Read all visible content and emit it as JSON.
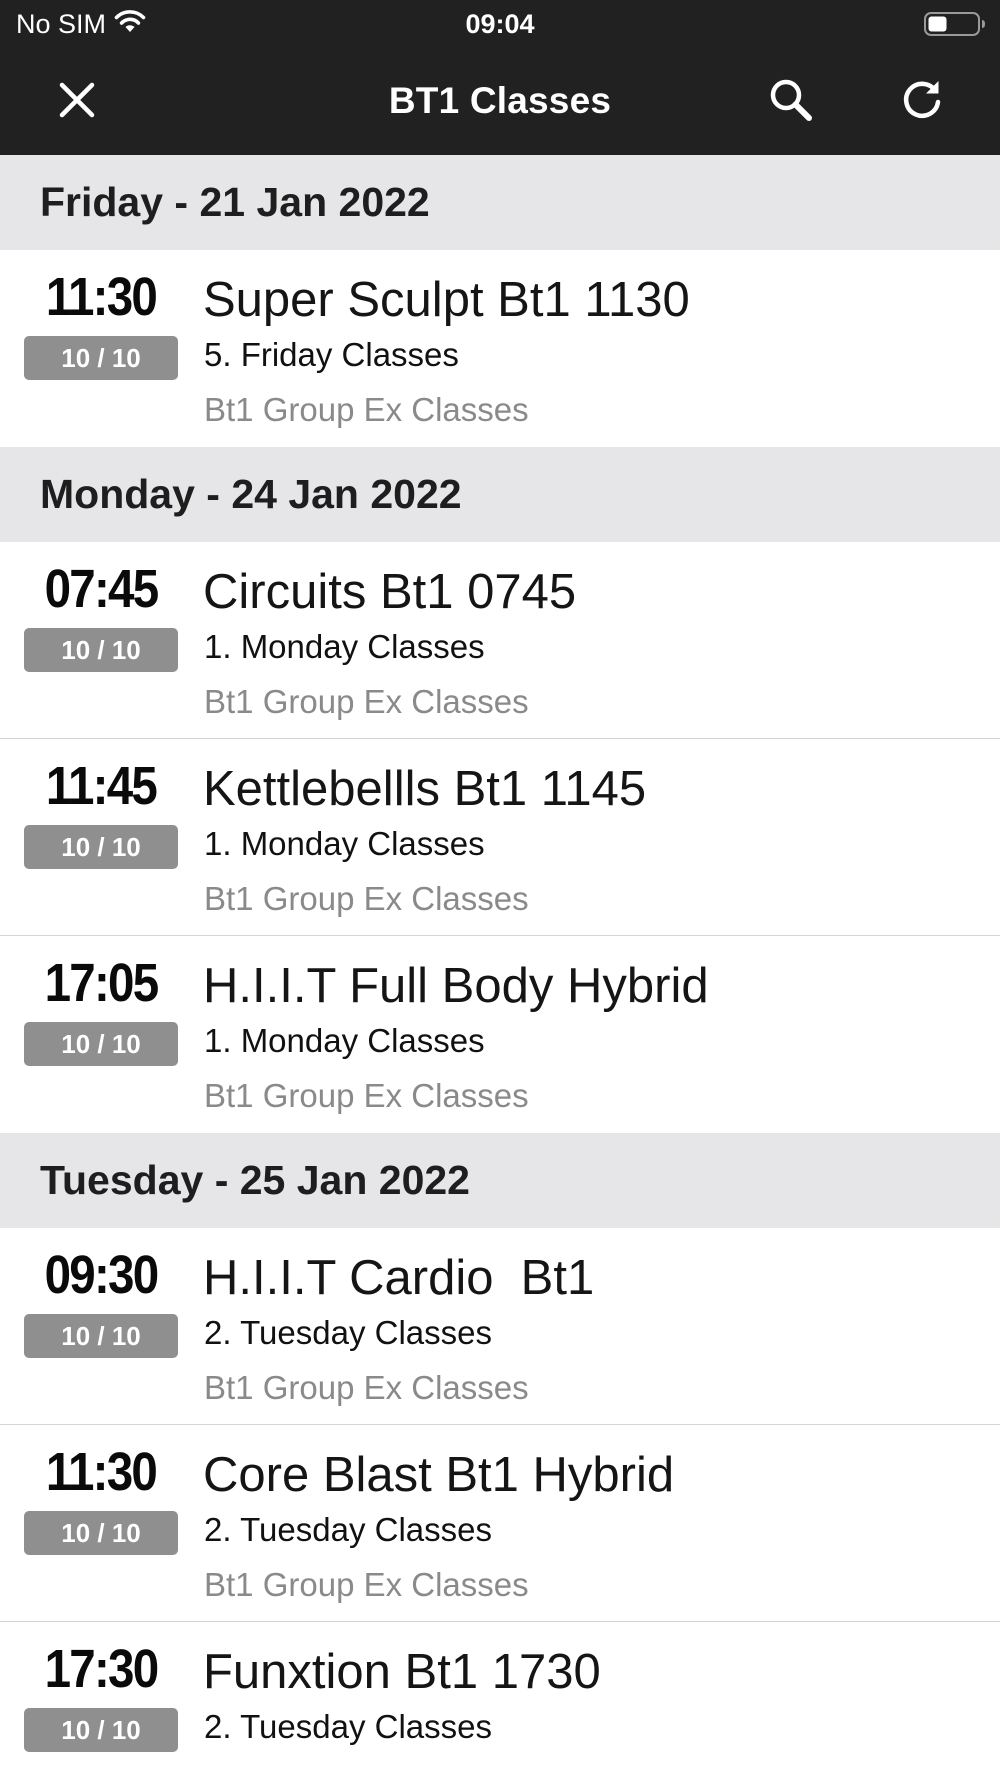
{
  "status_bar": {
    "carrier": "No SIM",
    "time": "09:04"
  },
  "nav": {
    "title": "BT1 Classes",
    "icons": {
      "close": "close-icon",
      "search": "search-icon",
      "refresh": "refresh-icon"
    }
  },
  "colors": {
    "nav_background": "#212121",
    "day_header_background": "#e6e6e8",
    "capacity_badge": "#8f8f8f",
    "muted_text": "#8a8a8a"
  },
  "days": [
    {
      "header": "Friday - 21 Jan 2022",
      "classes": [
        {
          "time": "11:30",
          "capacity": "10 / 10",
          "name": "Super Sculpt Bt1 1130",
          "category": "5. Friday Classes",
          "group": "Bt1 Group Ex Classes"
        }
      ]
    },
    {
      "header": "Monday - 24 Jan 2022",
      "classes": [
        {
          "time": "07:45",
          "capacity": "10 / 10",
          "name": "Circuits Bt1 0745",
          "category": "1. Monday Classes",
          "group": "Bt1 Group Ex Classes"
        },
        {
          "time": "11:45",
          "capacity": "10 / 10",
          "name": "Kettlebellls Bt1 1145",
          "category": "1. Monday Classes",
          "group": "Bt1 Group Ex Classes"
        },
        {
          "time": "17:05",
          "capacity": "10 / 10",
          "name": "H.I.I.T Full Body Hybrid",
          "category": "1. Monday Classes",
          "group": "Bt1 Group Ex Classes"
        }
      ]
    },
    {
      "header": "Tuesday - 25 Jan 2022",
      "classes": [
        {
          "time": "09:30",
          "capacity": "10 / 10",
          "name": "H.I.I.T Cardio  Bt1",
          "category": "2. Tuesday Classes",
          "group": "Bt1 Group Ex Classes"
        },
        {
          "time": "11:30",
          "capacity": "10 / 10",
          "name": "Core Blast Bt1 Hybrid",
          "category": "2. Tuesday Classes",
          "group": "Bt1 Group Ex Classes"
        },
        {
          "time": "17:30",
          "capacity": "10 / 10",
          "name": "Funxtion Bt1 1730",
          "category": "2. Tuesday Classes",
          "group": ""
        }
      ]
    }
  ]
}
